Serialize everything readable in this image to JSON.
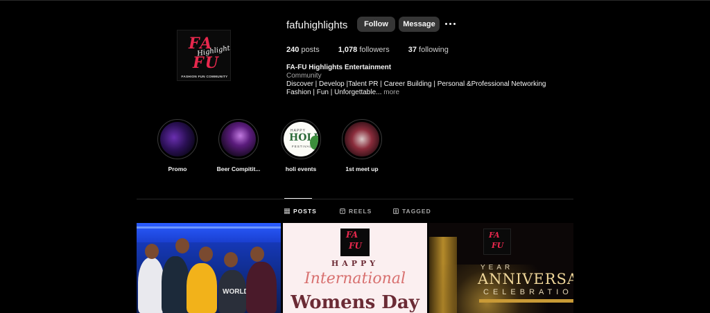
{
  "profile": {
    "username": "fafuhighlights",
    "follow_label": "Follow",
    "message_label": "Message",
    "more_icon": "more-options-icon",
    "logo": {
      "line1": "FA",
      "script": "Highlights",
      "line2": "FU",
      "tagline": "FASHION FUN COMMUNITY"
    }
  },
  "stats": {
    "posts": {
      "count": "240",
      "label": "posts"
    },
    "followers": {
      "count": "1,078",
      "label": "followers"
    },
    "following": {
      "count": "37",
      "label": "following"
    }
  },
  "bio": {
    "name": "FA-FU Highlights Entertainment",
    "category": "Community",
    "line1": "Discover | Develop |Talent PR | Career Building | Personal &Professional Networking",
    "line2": "Fashion | Fun | Unforgettable...",
    "more": " more"
  },
  "highlights": [
    {
      "label": "Promo"
    },
    {
      "label": "Beer Compitit..."
    },
    {
      "label": "holi events",
      "thumb_text": {
        "top": "HAPPY",
        "main": "HOLI",
        "bottom": "FESTIVAL"
      }
    },
    {
      "label": "1st meet up"
    }
  ],
  "tabs": [
    {
      "label": "POSTS",
      "icon": "grid-icon",
      "active": true
    },
    {
      "label": "REELS",
      "icon": "reels-icon",
      "active": false
    },
    {
      "label": "TAGGED",
      "icon": "tagged-icon",
      "active": false
    }
  ],
  "posts": {
    "p1": {
      "shirt_text": "WORLD"
    },
    "p2": {
      "logo_line1": "FA",
      "logo_line2": "FU",
      "happy": "HAPPY",
      "intl": "International",
      "womens": "Womens Day"
    },
    "p3": {
      "logo_line1": "FA",
      "logo_line2": "FU",
      "year": "YEAR",
      "anniversary": "ANNIVERSAR",
      "celebration": "CELEBRATIO"
    }
  }
}
